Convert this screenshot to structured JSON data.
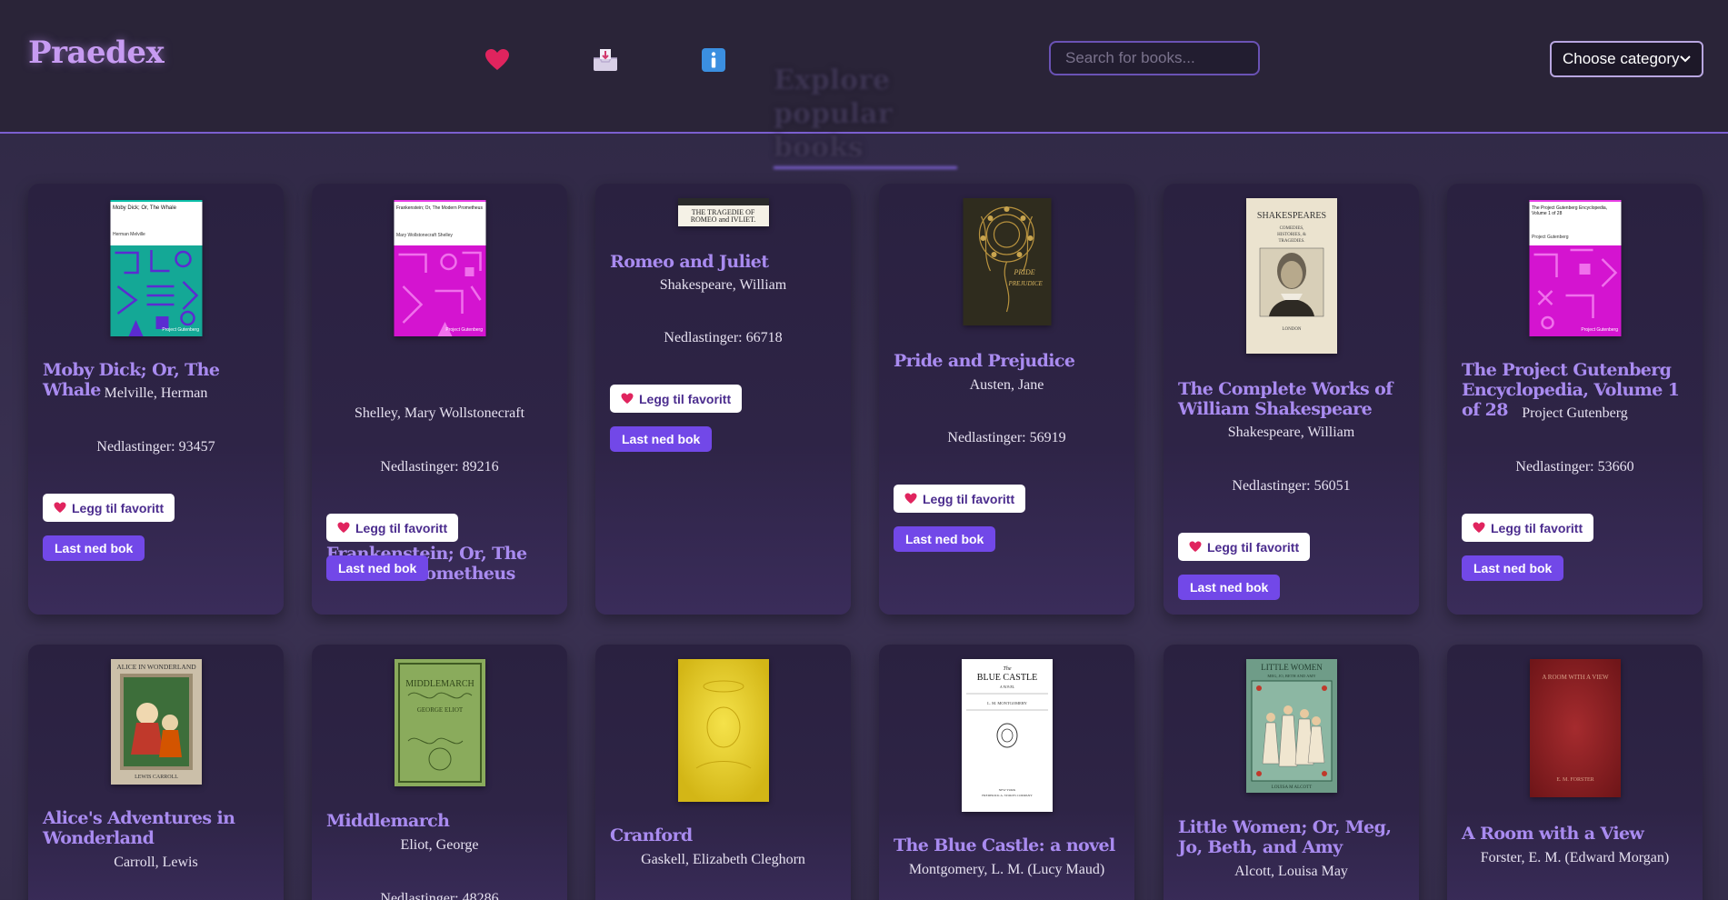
{
  "app": {
    "title": "Praedex"
  },
  "nav": {
    "favorites_icon": "heart-icon",
    "inbox_icon": "inbox-tray-icon",
    "info_icon": "info-icon"
  },
  "hero": {
    "text": "Explore popular books"
  },
  "search": {
    "placeholder": "Search for books..."
  },
  "category": {
    "selected": "Choose category",
    "icon": "chevron-down-icon"
  },
  "labels": {
    "favorite": "Legg til favoritt",
    "download": "Last ned bok"
  },
  "colors": {
    "accent": "#7248e8",
    "title": "#a98bf0",
    "logo": "#c79bf2",
    "heart": "#e0245e"
  },
  "books": [
    {
      "title": "Moby Dick; Or, The Whale",
      "author": "Melville, Herman",
      "downloads": "Nedlastinger: 93457",
      "cover_title": "Moby Dick; Or, The Whale",
      "cover_author": "Herman Melville",
      "cover_publisher": "Project Gutenberg"
    },
    {
      "title": "Frankenstein; Or, The Modern Prometheus",
      "author": "Shelley, Mary Wollstonecraft",
      "downloads": "Nedlastinger: 89216",
      "cover_title": "Frankenstein; Or, The Modern Prometheus",
      "cover_author": "Mary Wollstonecraft Shelley",
      "cover_publisher": "Project Gutenberg"
    },
    {
      "title": "Romeo and Juliet",
      "author": "Shakespeare, William",
      "downloads": "Nedlastinger: 66718",
      "cover_title": "THE TRAGEDIE OF ROMEO and IVLIET."
    },
    {
      "title": "Pride and Prejudice",
      "author": "Austen, Jane",
      "downloads": "Nedlastinger: 56919",
      "cover_title": "PRIDE AND PREJUDICE"
    },
    {
      "title": "The Complete Works of William Shakespeare",
      "author": "Shakespeare, William",
      "downloads": "Nedlastinger: 56051",
      "cover_title": "SHAKESPEARES",
      "cover_subtitle": "COMEDIES, HISTORIES, & TRAGEDIES."
    },
    {
      "title": "The Project Gutenberg Encyclopedia, Volume 1 of 28",
      "author": "Project Gutenberg",
      "downloads": "Nedlastinger: 53660",
      "cover_title": "The Project Gutenberg Encyclopedia, Volume 1 of 28",
      "cover_author": "Project Gutenberg",
      "cover_publisher": "Project Gutenberg"
    },
    {
      "title": "Alice's Adventures in Wonderland",
      "author": "Carroll, Lewis",
      "downloads": "",
      "cover_title": "ALICE IN WONDERLAND",
      "cover_author": "LEWIS CARROLL"
    },
    {
      "title": "Middlemarch",
      "author": "Eliot, George",
      "downloads": "Nedlastinger: 48286",
      "cover_title": "MIDDLEMARCH",
      "cover_author": "GEORGE ELIOT"
    },
    {
      "title": "Cranford",
      "author": "Gaskell, Elizabeth Cleghorn",
      "downloads": ""
    },
    {
      "title": "The Blue Castle: a novel",
      "author": "Montgomery, L. M. (Lucy Maud)",
      "downloads": "",
      "cover_title": "BLUE CASTLE",
      "cover_author": "L. M. MONTGOMERY"
    },
    {
      "title": "Little Women; Or, Meg, Jo, Beth, and Amy",
      "author": "Alcott, Louisa May",
      "downloads": "",
      "cover_title": "LITTLE WOMEN",
      "cover_subtitle": "MEG, JO, BETH AND AMY",
      "cover_author": "LOUISA M ALCOTT"
    },
    {
      "title": "A Room with a View",
      "author": "Forster, E. M. (Edward Morgan)",
      "downloads": "",
      "cover_title": "A ROOM WITH A VIEW",
      "cover_author": "E. M. FORSTER"
    }
  ]
}
